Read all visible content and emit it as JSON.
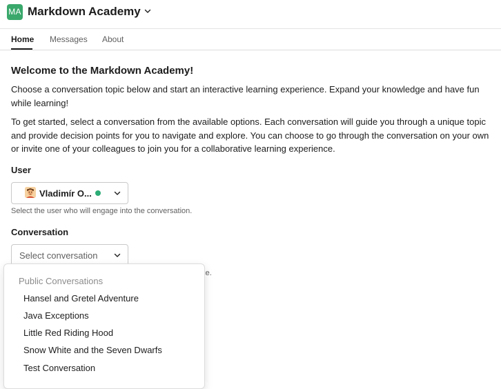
{
  "app": {
    "icon_text": "MA",
    "title": "Markdown Academy"
  },
  "tabs": [
    {
      "label": "Home",
      "active": true
    },
    {
      "label": "Messages",
      "active": false
    },
    {
      "label": "About",
      "active": false
    }
  ],
  "content": {
    "heading": "Welcome to the Markdown Academy!",
    "intro": "Choose a conversation topic below and start an interactive learning experience. Expand your knowledge and have fun while learning!",
    "instructions": "To get started, select a conversation from the available options. Each conversation will guide you through a unique topic and provide decision points for you to navigate and explore. You can choose to go through the conversation on your own or invite one of your colleagues to join you for a collaborative learning experience."
  },
  "user_field": {
    "label": "User",
    "selected": "Vladimír O...",
    "presence": "active",
    "hint": "Select the user who will engage into the conversation."
  },
  "conversation_field": {
    "label": "Conversation",
    "placeholder": "Select conversation",
    "hint_visible": "nce."
  },
  "dropdown": {
    "group_label": "Public Conversations",
    "options": [
      "Hansel and Gretel Adventure",
      "Java Exceptions",
      "Little Red Riding Hood",
      "Snow White and the Seven Dwarfs",
      "Test Conversation"
    ]
  },
  "colors": {
    "brand": "#3aa86b",
    "presence": "#2bac76",
    "text": "#1d1c1d",
    "muted": "#616061"
  }
}
